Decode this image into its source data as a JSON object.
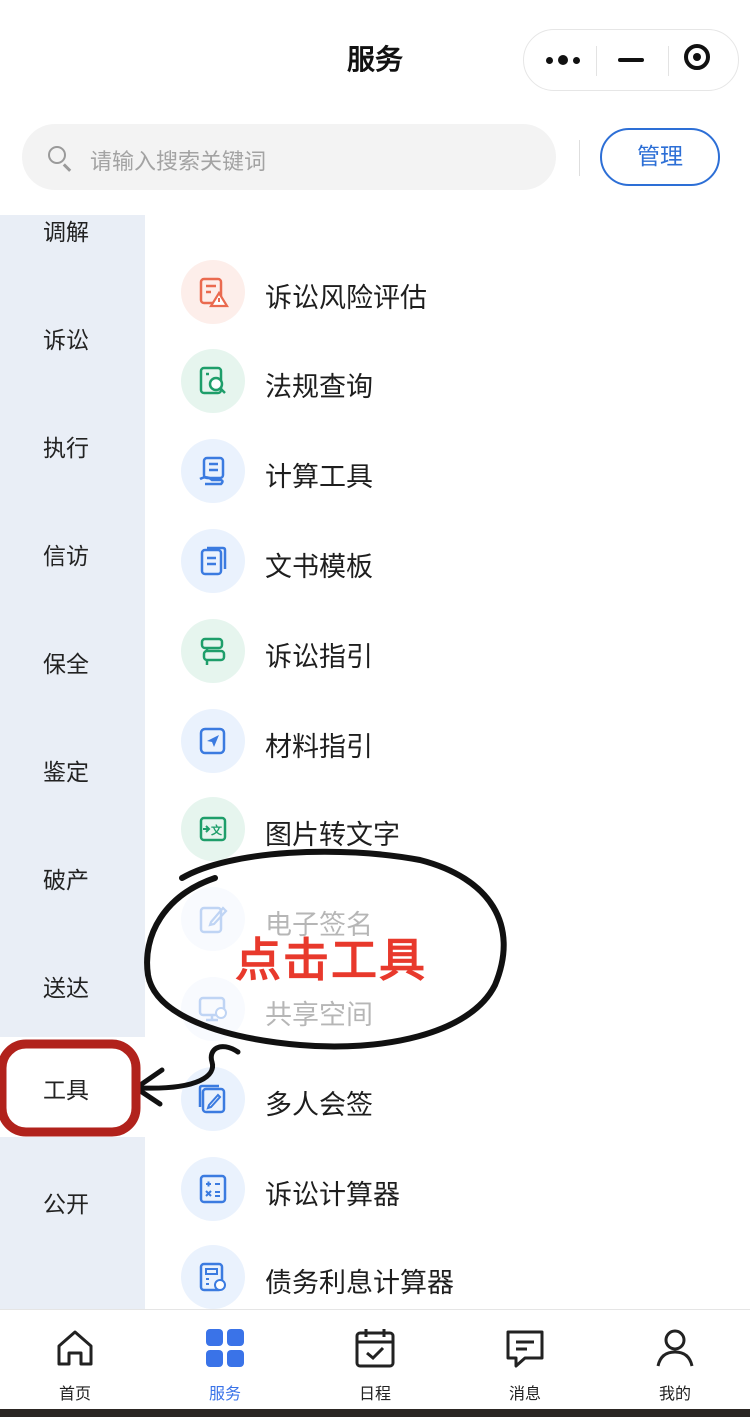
{
  "header": {
    "title": "服务"
  },
  "search": {
    "placeholder": "请输入搜索关键词",
    "manage_label": "管理"
  },
  "sidebar": {
    "items": [
      {
        "label": "调解"
      },
      {
        "label": "诉讼"
      },
      {
        "label": "执行"
      },
      {
        "label": "信访"
      },
      {
        "label": "保全"
      },
      {
        "label": "鉴定"
      },
      {
        "label": "破产"
      },
      {
        "label": "送达"
      },
      {
        "label": "工具"
      },
      {
        "label": "公开"
      }
    ],
    "selected": "工具"
  },
  "services": {
    "items": [
      {
        "label": "诉讼风险评估",
        "icon": "risk-assessment-icon",
        "color": "#ea6a4f"
      },
      {
        "label": "法规查询",
        "icon": "law-search-icon",
        "color": "#1e9e6a"
      },
      {
        "label": "计算工具",
        "icon": "calculator-document-icon",
        "color": "#3b7be0"
      },
      {
        "label": "文书模板",
        "icon": "template-document-icon",
        "color": "#3b7be0"
      },
      {
        "label": "诉讼指引",
        "icon": "signpost-icon",
        "color": "#1e9e6a"
      },
      {
        "label": "材料指引",
        "icon": "navigation-arrow-icon",
        "color": "#3b7be0"
      },
      {
        "label": "图片转文字",
        "icon": "image-to-text-icon",
        "color": "#1e9e6a"
      },
      {
        "label": "电子签名",
        "icon": "e-signature-icon",
        "color": "#3b7be0"
      },
      {
        "label": "共享空间",
        "icon": "shared-space-icon",
        "color": "#3b7be0"
      },
      {
        "label": "多人会签",
        "icon": "multi-sign-icon",
        "color": "#3b7be0"
      },
      {
        "label": "诉讼计算器",
        "icon": "calculator-icon",
        "color": "#3b7be0"
      },
      {
        "label": "债务利息计算器",
        "icon": "interest-calculator-icon",
        "color": "#3b7be0"
      }
    ]
  },
  "annotation": {
    "text": "点击工具",
    "color": "#e8392c",
    "highlight_color": "#b1221c"
  },
  "tabbar": {
    "items": [
      {
        "label": "首页",
        "icon": "home-icon"
      },
      {
        "label": "服务",
        "icon": "grid-icon"
      },
      {
        "label": "日程",
        "icon": "calendar-icon"
      },
      {
        "label": "消息",
        "icon": "message-icon"
      },
      {
        "label": "我的",
        "icon": "user-icon"
      }
    ],
    "active": "服务",
    "accent": "#3a73e8"
  }
}
